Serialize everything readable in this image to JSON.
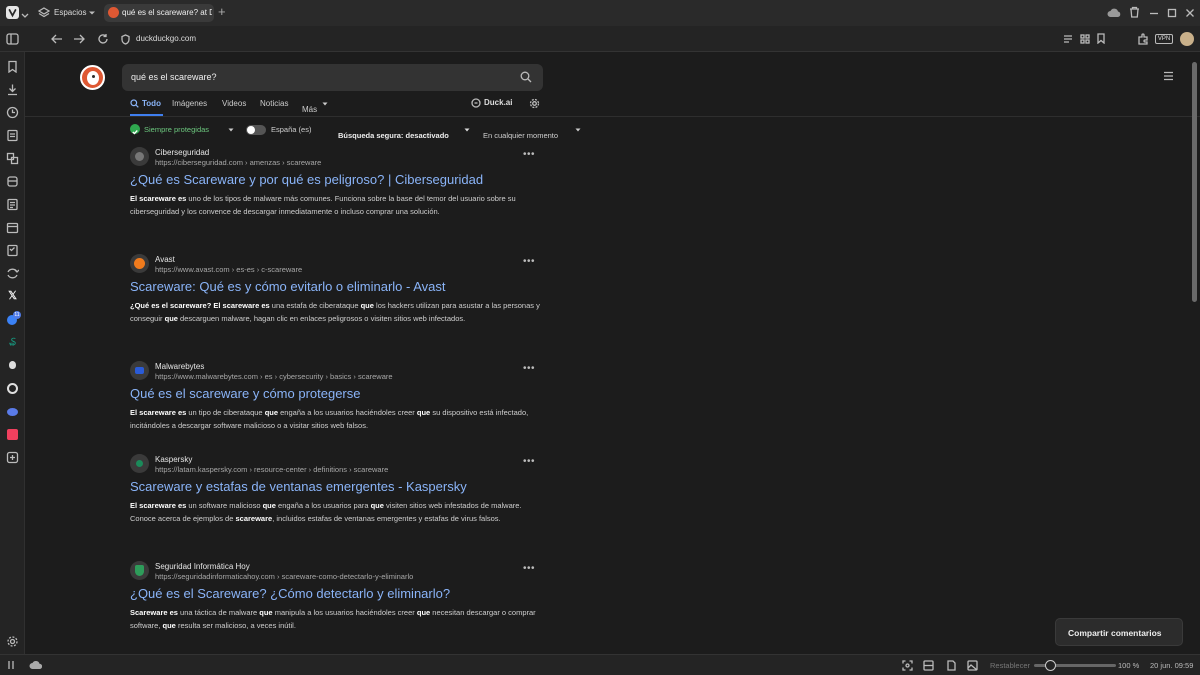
{
  "browser": {
    "spaces_label": "Espacios",
    "tab_title": "qué es el scareware? at Duc",
    "url": "duckduckgo.com",
    "vpn_label": "VPN"
  },
  "search": {
    "query": "qué es el scareware?",
    "tabs": [
      "Todo",
      "Imágenes",
      "Videos",
      "Noticias",
      "Más"
    ],
    "duck_ai": "Duck.ai",
    "filters": {
      "protected": "Siempre protegidas",
      "region": "España (es)",
      "safe": "Búsqueda segura: desactivado",
      "time": "En cualquier momento"
    }
  },
  "results": [
    {
      "source": "Ciberseguridad",
      "url": "https://ciberseguridad.com › amenzas › scareware",
      "title": "¿Qué es Scareware y por qué es peligroso? | Ciberseguridad",
      "snippet": "<b>El scareware es</b> uno de los tipos de malware más comunes. Funciona sobre la base del temor del usuario sobre su ciberseguridad y los convence de descargar inmediatamente o incluso comprar una solución."
    },
    {
      "source": "Avast",
      "url": "https://www.avast.com › es-es › c-scareware",
      "title": "Scareware: Qué es y cómo evitarlo o eliminarlo - Avast",
      "snippet": "<b>¿Qué es el scareware? El scareware es</b> una estafa de ciberataque <b>que</b> los hackers utilizan para asustar a las personas y conseguir <b>que</b> descarguen malware, hagan clic en enlaces peligrosos o visiten sitios web infectados."
    },
    {
      "source": "Malwarebytes",
      "url": "https://www.malwarebytes.com › es › cybersecurity › basics › scareware",
      "title": "Qué es el scareware y cómo protegerse",
      "snippet": "<b>El scareware es</b> un tipo de ciberataque <b>que</b> engaña a los usuarios haciéndoles creer <b>que</b> su dispositivo está infectado, incitándoles a descargar software malicioso o a visitar sitios web falsos."
    },
    {
      "source": "Kaspersky",
      "url": "https://latam.kaspersky.com › resource-center › definitions › scareware",
      "title": "Scareware y estafas de ventanas emergentes - Kaspersky",
      "snippet": "<b>El scareware es</b> un software malicioso <b>que</b> engaña a los usuarios para <b>que</b> visiten sitios web infestados de malware. Conoce acerca de ejemplos de <b>scareware</b>, incluidos estafas de ventanas emergentes y estafas de virus falsos."
    },
    {
      "source": "Seguridad Informática Hoy",
      "url": "https://seguridadinformaticahoy.com › scareware-como-detectarlo-y-eliminarlo",
      "title": "¿Qué es el Scareware? ¿Cómo detectarlo y eliminarlo?",
      "snippet": "<b>Scareware es</b> una táctica de malware <b>que</b> manipula a los usuarios haciéndoles creer <b>que</b> necesitan descargar o comprar software, <b>que</b> resulta ser malicioso, a veces inútil."
    }
  ],
  "feedback_button": "Compartir comentarios",
  "status": {
    "reset": "Restablecer",
    "zoom": "100 %",
    "datetime": "20 jun. 09:59"
  },
  "colors": {
    "link": "#8ab4f8",
    "accent": "#3f7fef",
    "ddg_orange": "#de5833"
  }
}
